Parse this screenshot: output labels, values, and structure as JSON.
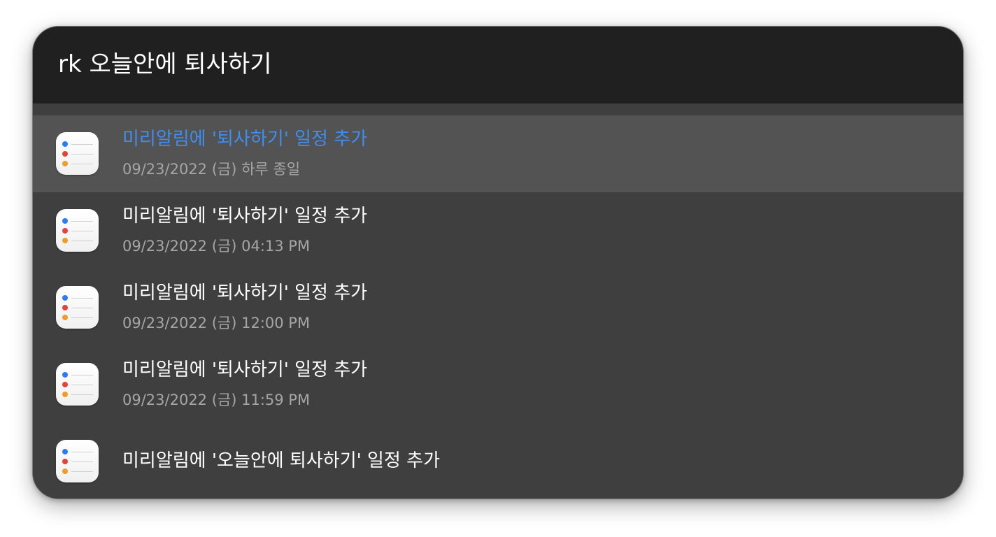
{
  "search": {
    "query": "rk 오늘안에 퇴사하기"
  },
  "results": [
    {
      "title": "미리알림에 '퇴사하기' 일정 추가",
      "subtitle": "09/23/2022 (금) 하루 종일",
      "selected": true,
      "icon": "reminders-app-icon"
    },
    {
      "title": "미리알림에 '퇴사하기' 일정 추가",
      "subtitle": "09/23/2022 (금) 04:13 PM",
      "selected": false,
      "icon": "reminders-app-icon"
    },
    {
      "title": "미리알림에 '퇴사하기' 일정 추가",
      "subtitle": "09/23/2022 (금) 12:00 PM",
      "selected": false,
      "icon": "reminders-app-icon"
    },
    {
      "title": "미리알림에 '퇴사하기' 일정 추가",
      "subtitle": "09/23/2022 (금) 11:59 PM",
      "selected": false,
      "icon": "reminders-app-icon"
    },
    {
      "title": "미리알림에 '오늘안에 퇴사하기' 일정 추가",
      "subtitle": "",
      "selected": false,
      "icon": "reminders-app-icon"
    }
  ],
  "colors": {
    "panel_background": "#3f3f3f",
    "search_background": "#202020",
    "selected_row": "#535353",
    "selected_title": "#3f8df0",
    "reminder_dot_blue": "#2d7cf6",
    "reminder_dot_red": "#e0443a",
    "reminder_dot_orange": "#f29a2e"
  }
}
